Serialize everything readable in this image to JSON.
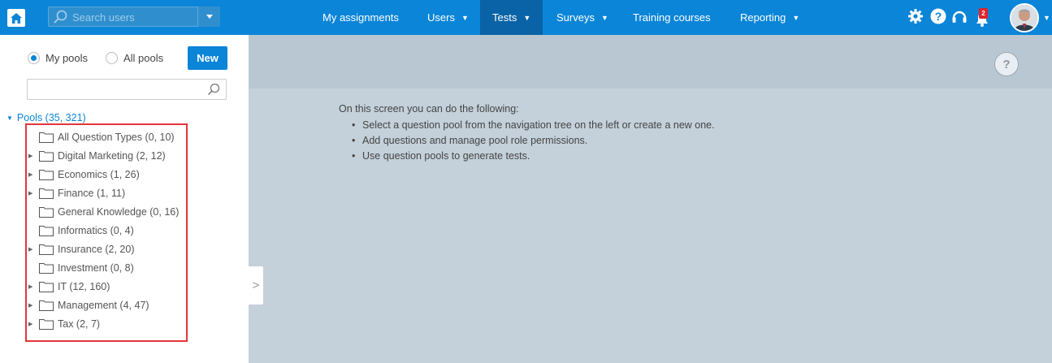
{
  "header": {
    "search_placeholder": "Search users",
    "nav": [
      {
        "label": "My assignments",
        "has_caret": false
      },
      {
        "label": "Users",
        "has_caret": true
      },
      {
        "label": "Tests",
        "has_caret": true,
        "active": true
      },
      {
        "label": "Surveys",
        "has_caret": true
      },
      {
        "label": "Training courses",
        "has_caret": false
      },
      {
        "label": "Reporting",
        "has_caret": true
      }
    ],
    "notification_count": "2",
    "icons": [
      "home-icon",
      "search-icon",
      "chevron-down-icon",
      "gear-icon",
      "help-icon",
      "headset-icon",
      "bell-icon",
      "avatar"
    ]
  },
  "left_panel": {
    "radio_options": [
      {
        "label": "My pools",
        "selected": true
      },
      {
        "label": "All pools",
        "selected": false
      }
    ],
    "new_button": "New",
    "filter_value": "",
    "tree_root": "Pools (35, 321)",
    "tree_items": [
      {
        "label": "All Question Types (0, 10)",
        "expandable": false
      },
      {
        "label": "Digital Marketing (2, 12)",
        "expandable": true
      },
      {
        "label": "Economics (1, 26)",
        "expandable": true
      },
      {
        "label": "Finance (1, 11)",
        "expandable": true
      },
      {
        "label": "General Knowledge (0, 16)",
        "expandable": false
      },
      {
        "label": "Informatics (0, 4)",
        "expandable": false
      },
      {
        "label": "Insurance (2, 20)",
        "expandable": true
      },
      {
        "label": "Investment (0, 8)",
        "expandable": false
      },
      {
        "label": "IT (12, 160)",
        "expandable": true
      },
      {
        "label": "Management (4, 47)",
        "expandable": true
      },
      {
        "label": "Tax (2, 7)",
        "expandable": true
      }
    ]
  },
  "main": {
    "help_label": "?",
    "intro": "On this screen you can do the following:",
    "bullets": [
      "Select a question pool from the navigation tree on the left or create a new one.",
      "Add questions and manage pool role permissions.",
      "Use question pools to generate tests."
    ]
  },
  "colors": {
    "topbar": "#0b85d8",
    "active_nav": "#0a63a6",
    "main_bg": "#c4d1da",
    "highlight_border": "#e2373b"
  }
}
